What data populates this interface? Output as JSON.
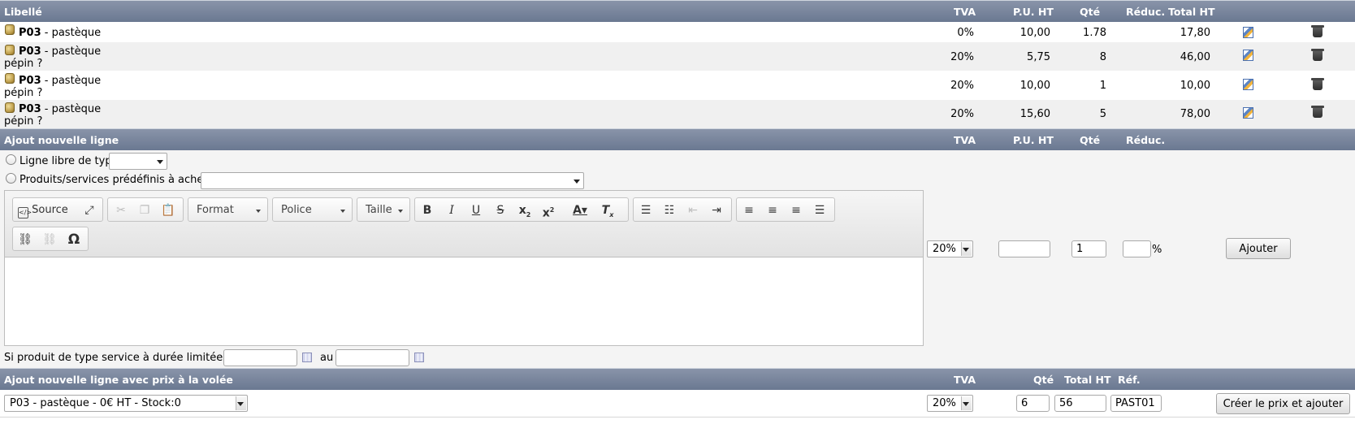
{
  "lines_header": {
    "libelle": "Libellé",
    "tva": "TVA",
    "pu_ht": "P.U. HT",
    "qte": "Qté",
    "reduc": "Réduc.",
    "total_ht": "Total HT"
  },
  "lines": [
    {
      "ref": "P03",
      "label": " - pastèque",
      "label2": "",
      "tva": "0%",
      "pu_ht": "10,00",
      "qte": "1.78",
      "total_ht": "17,80"
    },
    {
      "ref": "P03",
      "label": " - pastèque",
      "label2": "pépin ?",
      "tva": "20%",
      "pu_ht": "5,75",
      "qte": "8",
      "total_ht": "46,00"
    },
    {
      "ref": "P03",
      "label": " - pastèque",
      "label2": "pépin ?",
      "tva": "20%",
      "pu_ht": "10,00",
      "qte": "1",
      "total_ht": "10,00"
    },
    {
      "ref": "P03",
      "label": " - pastèque",
      "label2": "pépin ?",
      "tva": "20%",
      "pu_ht": "15,60",
      "qte": "5",
      "total_ht": "78,00"
    }
  ],
  "add_header": {
    "title": "Ajout nouvelle ligne",
    "tva": "TVA",
    "pu_ht": "P.U. HT",
    "qte": "Qté",
    "reduc": "Réduc."
  },
  "add_form": {
    "free_line_label": "Ligne libre de type",
    "free_line_type": "",
    "predefined_label": "Produits/services prédéfinis à acheter",
    "predefined_value": "",
    "tva_value": "20%",
    "pu_value": "",
    "qte_value": "1",
    "reduc_value": "",
    "percent": "%",
    "add_button": "Ajouter"
  },
  "editor_toolbar": {
    "source": "Source",
    "format": "Format",
    "police": "Police",
    "taille": "Taille"
  },
  "service_dates": {
    "label": "Si produit de type service à durée limitée : Du",
    "au": "au",
    "from_value": "",
    "to_value": ""
  },
  "fly_header": {
    "title": "Ajout nouvelle ligne avec prix à la volée",
    "tva": "TVA",
    "qte": "Qté",
    "total_ht": "Total HT",
    "ref": "Réf."
  },
  "fly_form": {
    "product": "P03 - pastèque - 0€ HT - Stock:0",
    "tva": "20%",
    "qte": "6",
    "total_ht": "56",
    "ref": "PAST01",
    "button": "Créer le prix et ajouter"
  }
}
